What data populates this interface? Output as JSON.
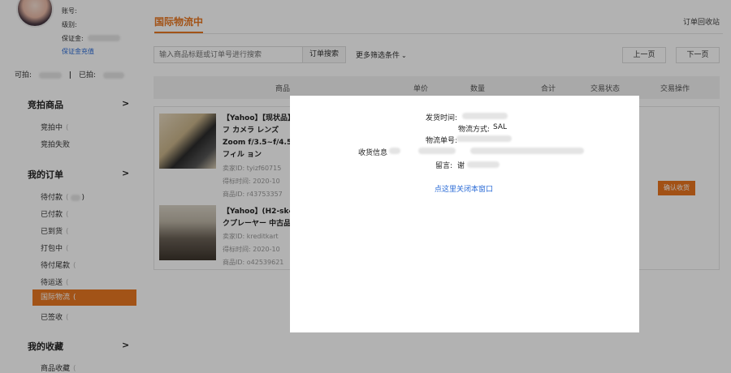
{
  "account": {
    "account_label": "账号:",
    "level_label": "级别:",
    "deposit_label": "保证金:",
    "deposit_link": "保证金充值",
    "bid_label": "可拍:",
    "bid_sep": "|",
    "bidded_label": "已拍:"
  },
  "sidebar": {
    "auction_goods": {
      "title": "竞拍商品",
      "items": [
        {
          "label": "竞拍中"
        },
        {
          "label": "竞拍失败"
        }
      ]
    },
    "my_orders": {
      "title": "我的订单",
      "items": [
        {
          "label": "待付款"
        },
        {
          "label": "已付款"
        },
        {
          "label": "已到货"
        },
        {
          "label": "打包中"
        },
        {
          "label": "待付尾款"
        },
        {
          "label": "待运送"
        },
        {
          "label": "国际物流"
        },
        {
          "label": "已签收"
        }
      ]
    },
    "favorites": {
      "title": "我的收藏",
      "items": [
        {
          "label": "商品收藏"
        }
      ]
    },
    "chevron": ">",
    "paren_open": "(",
    "paren_close": ")"
  },
  "main": {
    "title": "国际物流中",
    "recycle_link": "订单回收站",
    "search_placeholder": "输入商品标题或订单号进行搜索",
    "search_button": "订单搜索",
    "filter_link": "更多筛选条件",
    "prev_page": "上一页",
    "next_page": "下一页",
    "columns": [
      "商品",
      "单价",
      "数量",
      "合计",
      "交易状态",
      "交易操作"
    ],
    "items": [
      {
        "title": "【Yahoo】【现状品】フ カメラ レンズ Zoom f/3.5~f/4.5 フィル ョン",
        "seller": "卖家ID: tyizf60715",
        "time": "得标时间: 2020-10",
        "product_id": "商品ID: r43753357"
      },
      {
        "title": "【Yahoo】(H2-sk4 クプレーヤー 中古品",
        "seller": "卖家ID: kreditkart",
        "time": "得标时间: 2020-10",
        "product_id": "商品ID: o42539621"
      }
    ],
    "confirm_button": "确认收货"
  },
  "modal": {
    "ship_time_label": "发货时间:",
    "method_label": "物流方式:",
    "method_value": "SAL",
    "tracking_label": "物流单号:",
    "address_label": "收货信息",
    "comment_label": "留言:",
    "comment_value": "谢",
    "close_link": "点这里关闭本窗口"
  },
  "colors": {
    "accent": "#e87722",
    "link": "#2a6bd6",
    "overlay": "rgba(0,0,0,0.30)"
  }
}
